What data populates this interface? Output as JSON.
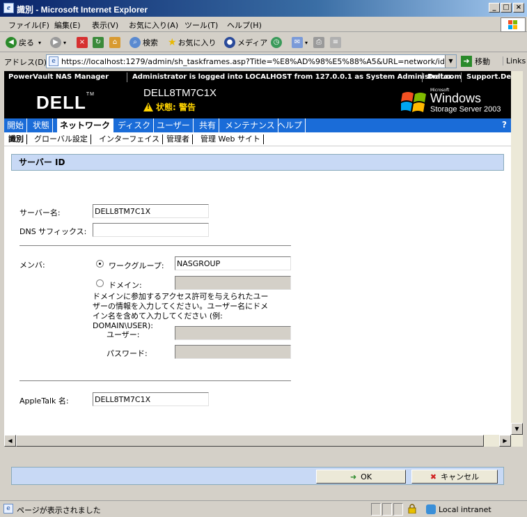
{
  "window": {
    "title": "識別 - Microsoft Internet Explorer"
  },
  "menu": [
    "ファイル(F)",
    "編集(E)",
    "表示(V)",
    "お気に入り(A)",
    "ツール(T)",
    "ヘルプ(H)"
  ],
  "toolbar": {
    "back": "戻る",
    "search": "検索",
    "favorites": "お気に入り",
    "media": "メディア"
  },
  "address": {
    "label": "アドレス(D)",
    "url": "https://localhost:1279/admin/sh_taskframes.asp?Title=%E8%AD%98%E5%88%A5&URL=network/id_prop.asp?t",
    "go": "移動",
    "links": "Links"
  },
  "nasbar": {
    "product": "PowerVault NAS Manager",
    "login": "Administrator is logged into LOCALHOST from 127.0.0.1 as System Administrator.",
    "dellcom": "Dell.com",
    "support": "Support.Dell."
  },
  "banner": {
    "logo": "DELL",
    "server_name": "DELL8TM7C1X",
    "status": "状態: 警告",
    "win_ms": "Microsoft",
    "win_name": "Windows",
    "win_sub": "Storage Server 2003"
  },
  "tabs": [
    "開始",
    "状態",
    "ネットワーク",
    "ディスク",
    "ユーザー",
    "共有",
    "メンテナンス",
    "ヘルプ"
  ],
  "help_mark": "?",
  "subtabs": [
    "識別",
    "グローバル設定",
    "インターフェイス",
    "管理者",
    "管理 Web サイト"
  ],
  "section_title": "サーバー ID",
  "form": {
    "server_name_label": "サーバー名:",
    "server_name_value": "DELL8TM7C1X",
    "dns_suffix_label": "DNS サフィックス:",
    "dns_suffix_value": "",
    "member_label": "メンバ:",
    "workgroup_label": "ワークグループ:",
    "workgroup_value": "NASGROUP",
    "domain_label": "ドメイン:",
    "domain_value": "",
    "help_text": "ドメインに参加するアクセス許可を与えられたユーザーの情報を入力してください。ユーザー名にドメイン名を含めて入力してください (例: DOMAIN\\USER):",
    "user_label": "ユーザー:",
    "password_label": "パスワード:",
    "appletalk_label": "AppleTalk 名:",
    "appletalk_value": "DELL8TM7C1X"
  },
  "buttons": {
    "ok": "OK",
    "cancel": "キャンセル"
  },
  "statusbar": {
    "text": "ページが表示されました",
    "zone": "Local intranet"
  }
}
